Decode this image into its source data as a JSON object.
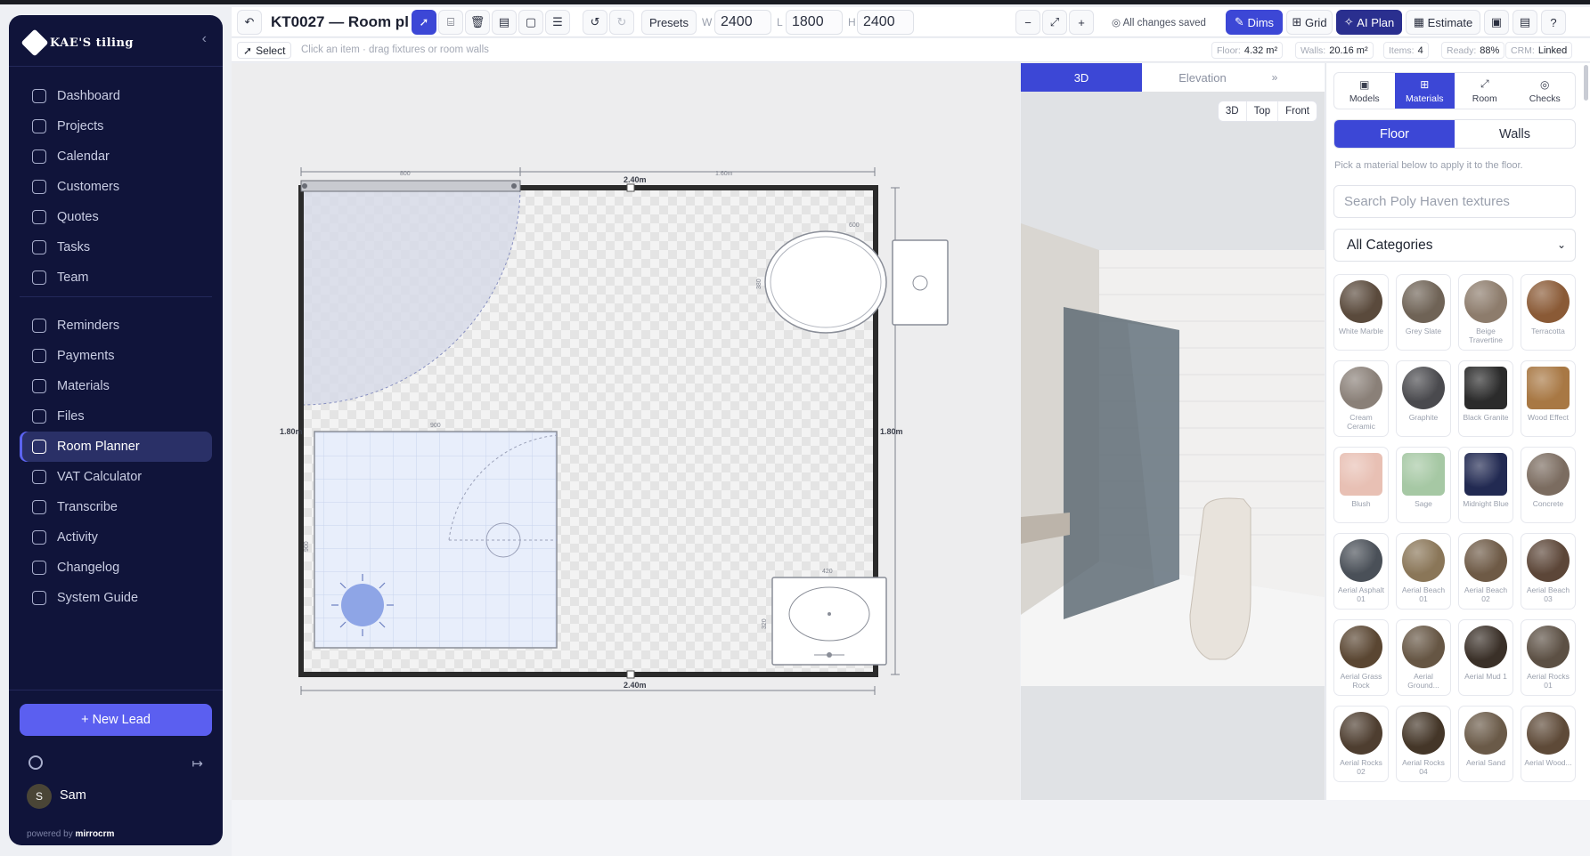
{
  "sidebar": {
    "brand": "KAE'S tiling",
    "items": [
      {
        "label": "Dashboard"
      },
      {
        "label": "Projects"
      },
      {
        "label": "Calendar"
      },
      {
        "label": "Customers"
      },
      {
        "label": "Quotes"
      },
      {
        "label": "Tasks"
      },
      {
        "label": "Team"
      },
      {
        "label": "Reminders"
      },
      {
        "label": "Payments"
      },
      {
        "label": "Materials"
      },
      {
        "label": "Files"
      },
      {
        "label": "Room Planner"
      },
      {
        "label": "VAT Calculator"
      },
      {
        "label": "Transcribe"
      },
      {
        "label": "Activity"
      },
      {
        "label": "Changelog"
      },
      {
        "label": "System Guide"
      }
    ],
    "new_lead": "+ New Lead",
    "user": {
      "initial": "S",
      "name": "Sam"
    },
    "powered_prefix": "powered by",
    "powered_brand": "mirrocrm"
  },
  "toolbar": {
    "title": "KT0027 — Room pl",
    "presets": "Presets",
    "w_label": "W",
    "w_value": "2400",
    "l_label": "L",
    "l_value": "1800",
    "h_label": "H",
    "h_value": "2400",
    "saved": "All changes saved",
    "dims": "Dims",
    "grid": "Grid",
    "ai_plan": "AI Plan",
    "estimate": "Estimate"
  },
  "status": {
    "mode": "Select",
    "hint": "Click an item · drag fixtures or room walls",
    "floor_label": "Floor:",
    "floor_value": "4.32 m²",
    "walls_label": "Walls:",
    "walls_value": "20.16 m²",
    "items_label": "Items:",
    "items_value": "4",
    "ready_label": "Ready:",
    "ready_value": "88%",
    "crm_label": "CRM:",
    "crm_value": "Linked"
  },
  "plan": {
    "top_dim": "2.40m",
    "bottom_dim": "2.40m",
    "left_dim": "1.80m",
    "right_dim": "1.80m",
    "door_width": "800",
    "gap_right": "1.60m",
    "bath_width": "600",
    "bath_depth": "380",
    "shower_width": "900",
    "shower_depth": "900",
    "basin_width": "420",
    "basin_depth": "320"
  },
  "view3d": {
    "tab_3d": "3D",
    "tab_elev": "Elevation",
    "seg": [
      "3D",
      "Top",
      "Front"
    ]
  },
  "panel": {
    "tabs": [
      "Models",
      "Materials",
      "Room",
      "Checks"
    ],
    "floor": "Floor",
    "walls": "Walls",
    "hint": "Pick a material below to apply it to the floor.",
    "search_placeholder": "Search Poly Haven textures",
    "category": "All Categories",
    "materials": [
      {
        "name": "White Marble",
        "color": "#5a4a3c"
      },
      {
        "name": "Grey Slate",
        "color": "#6f6356"
      },
      {
        "name": "Beige Travertine",
        "color": "#8d7c6c"
      },
      {
        "name": "Terracotta",
        "color": "#8a5a36"
      },
      {
        "name": "Cream Ceramic",
        "color": "#8a8078"
      },
      {
        "name": "Graphite",
        "color": "#4a4a4e"
      },
      {
        "name": "Black Granite",
        "color": "#2b2b2b"
      },
      {
        "name": "Wood Effect",
        "color": "#a87844"
      },
      {
        "name": "Blush",
        "color": "#e8c0b4"
      },
      {
        "name": "Sage",
        "color": "#a6c8a4"
      },
      {
        "name": "Midnight Blue",
        "color": "#222a52"
      },
      {
        "name": "Concrete",
        "color": "#7b6c60"
      },
      {
        "name": "Aerial Asphalt 01",
        "color": "#4a5058"
      },
      {
        "name": "Aerial Beach 01",
        "color": "#8a7658"
      },
      {
        "name": "Aerial Beach 02",
        "color": "#6e5a46"
      },
      {
        "name": "Aerial Beach 03",
        "color": "#5c4638"
      },
      {
        "name": "Aerial Grass Rock",
        "color": "#5a4632"
      },
      {
        "name": "Aerial Ground...",
        "color": "#665644"
      },
      {
        "name": "Aerial Mud 1",
        "color": "#3a3028"
      },
      {
        "name": "Aerial Rocks 01",
        "color": "#5c5044"
      },
      {
        "name": "Aerial Rocks 02",
        "color": "#4e3e30"
      },
      {
        "name": "Aerial Rocks 04",
        "color": "#443628"
      },
      {
        "name": "Aerial Sand",
        "color": "#6a5a48"
      },
      {
        "name": "Aerial Wood...",
        "color": "#5e4a38"
      }
    ]
  }
}
